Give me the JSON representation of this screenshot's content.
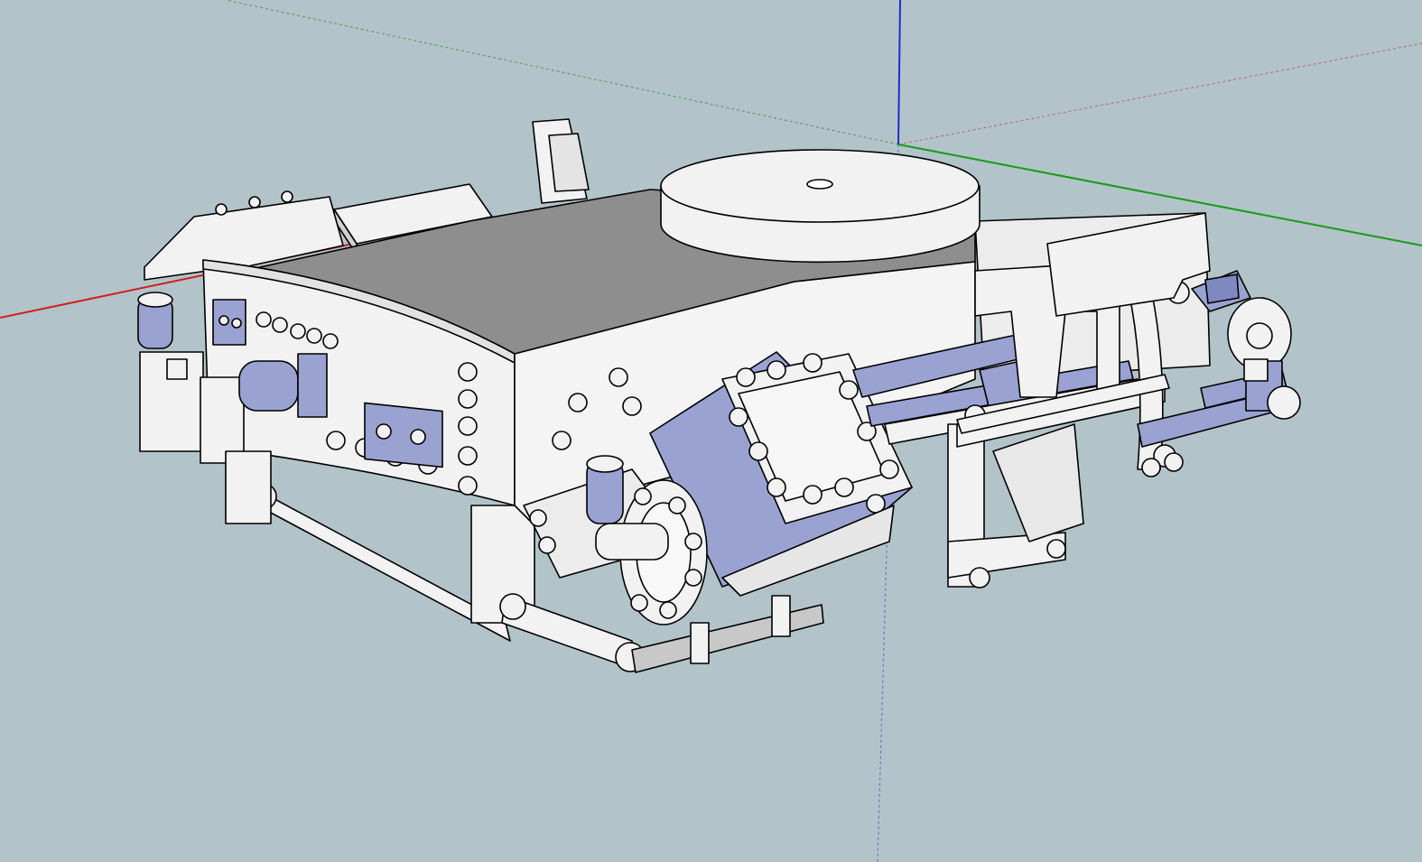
{
  "viewport": {
    "background": "#b2c4c9",
    "camera": "perspective",
    "render_style": "shaded with edges"
  },
  "axes": {
    "red_color": "#d21e1e",
    "green_color": "#1a9a1a",
    "blue_color": "#1e2ec8",
    "dashed_red_color": "#b47474",
    "dashed_green_color": "#5ea05e",
    "dashed_blue_color": "#6a78c0"
  },
  "model": {
    "face_color": "#f2f2f2",
    "top_face_color": "#8e8e8e",
    "accent_color": "#9aa2d2",
    "edge_color": "#000000"
  }
}
